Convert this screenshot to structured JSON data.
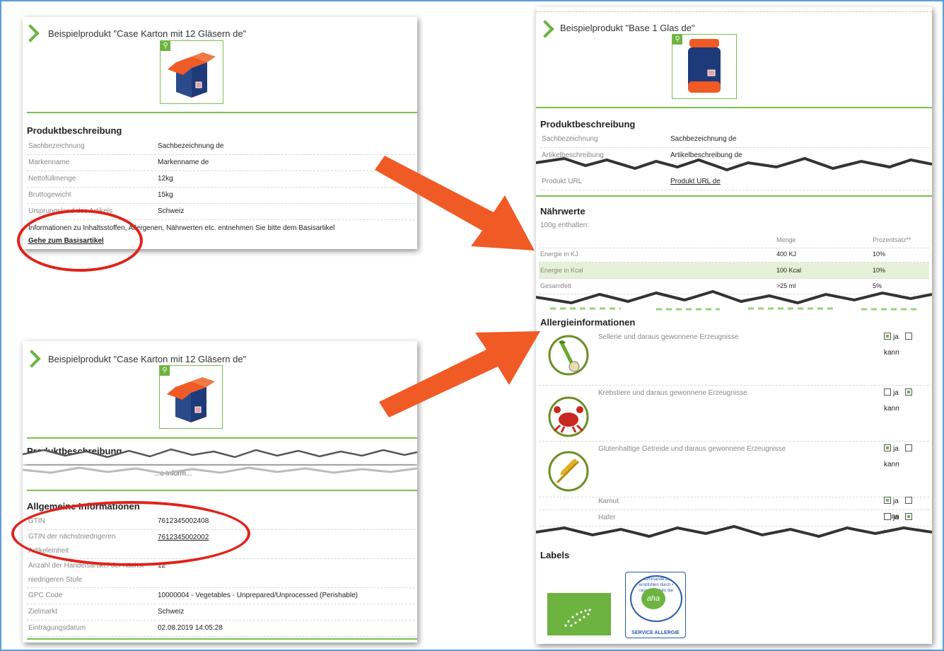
{
  "left_top": {
    "title": "Beispielprodukt \"Case Karton mit 12 Gläsern de\"",
    "section": "Produktbeschreibung",
    "rows": [
      {
        "label": "Sachbezeichnung",
        "value": "Sachbezeichnung de"
      },
      {
        "label": "Markenname",
        "value": "Markenname de"
      },
      {
        "label": "Nettofüllmenge",
        "value": "12kg"
      },
      {
        "label": "Bruttogewicht",
        "value": "15kg"
      },
      {
        "label": "Ursprungsland des Artikels",
        "value": "Schweiz"
      }
    ],
    "info_text": "Informationen zu Inhaltsstoffen, Allergenen, Nährwerten etc. entnehmen Sie bitte dem Basisartikel",
    "link": "Gehe zum Basisartikel"
  },
  "left_bottom": {
    "title": "Beispielprodukt \"Case Karton mit 12 Gläsern de\"",
    "section_torn": "Produktbeschreibung",
    "torn_text": "...e Inform...",
    "section": "Allgemeine Informationen",
    "rows": [
      {
        "label": "GTIN",
        "value": "7612345002408"
      },
      {
        "label": "GTIN der nächstniedrigeren Artikeleinheit",
        "value": "7612345002002"
      },
      {
        "label": "Anzahl der Handelsartikel der nächst niedrigeren Stufe",
        "value": "12"
      },
      {
        "label": "GPC Code",
        "value": "10000004 - Vegetables - Unprepared/Unprocessed (Perishable)"
      },
      {
        "label": "Zielmarkt",
        "value": "Schweiz"
      },
      {
        "label": "Eintragungsdatum",
        "value": "02.08.2019 14:05:28"
      }
    ]
  },
  "right": {
    "title": "Beispielprodukt \"Base 1 Glas de\"",
    "section_desc": "Produktbeschreibung",
    "desc_rows": [
      {
        "label": "Sachbezeichnung",
        "value": "Sachbezeichnung de"
      },
      {
        "label": "Artikelbeschreibung",
        "value": "Artikelbeschreibung de"
      },
      {
        "label": "Produkt URL",
        "value": "Produkt URL de"
      }
    ],
    "section_nutr": "Nährwerte",
    "nutr_sub": "100g enthalten:",
    "nutr_head": {
      "menge": "Menge",
      "pct": "Prozentsatz**"
    },
    "nutr_rows": [
      {
        "name": "Energie in KJ",
        "menge": "400 KJ",
        "pct": "10%"
      },
      {
        "name": "Energie in Kcal",
        "menge": "100 Kcal",
        "pct": "10%"
      },
      {
        "name": "Gesamtfett",
        "menge": ">25 ml",
        "pct": "5%"
      }
    ],
    "section_allergy": "Allergieinformationen",
    "allergy": [
      {
        "name": "Sellerie und daraus gewonnene Erzeugnisse",
        "ja": true,
        "kann": false
      },
      {
        "name": "Krebstiere und daraus gewonnene Erzeugnisse",
        "ja": false,
        "kann": true
      },
      {
        "name": "Glutenhaltige Getreide und daraus gewonnene Erzeugnisse",
        "ja": true,
        "kann": false
      }
    ],
    "sub_allergy": [
      {
        "name": "Kamut",
        "ja": true,
        "kann": false
      },
      {
        "name": "Hafer",
        "ja": false,
        "kann": true
      }
    ],
    "ja_label": "ja",
    "kann_label": "kann",
    "section_labels": "Labels",
    "aha_text": "SERVICE ALLERGIE",
    "aha_ring": "recommandé da • empfohlen durch • raccomandato dal",
    "aha_mark": "aha"
  },
  "colors": {
    "green": "#6cb33f",
    "orange": "#f05a24",
    "red": "#e0221b",
    "frame": "#5aa0d8"
  }
}
